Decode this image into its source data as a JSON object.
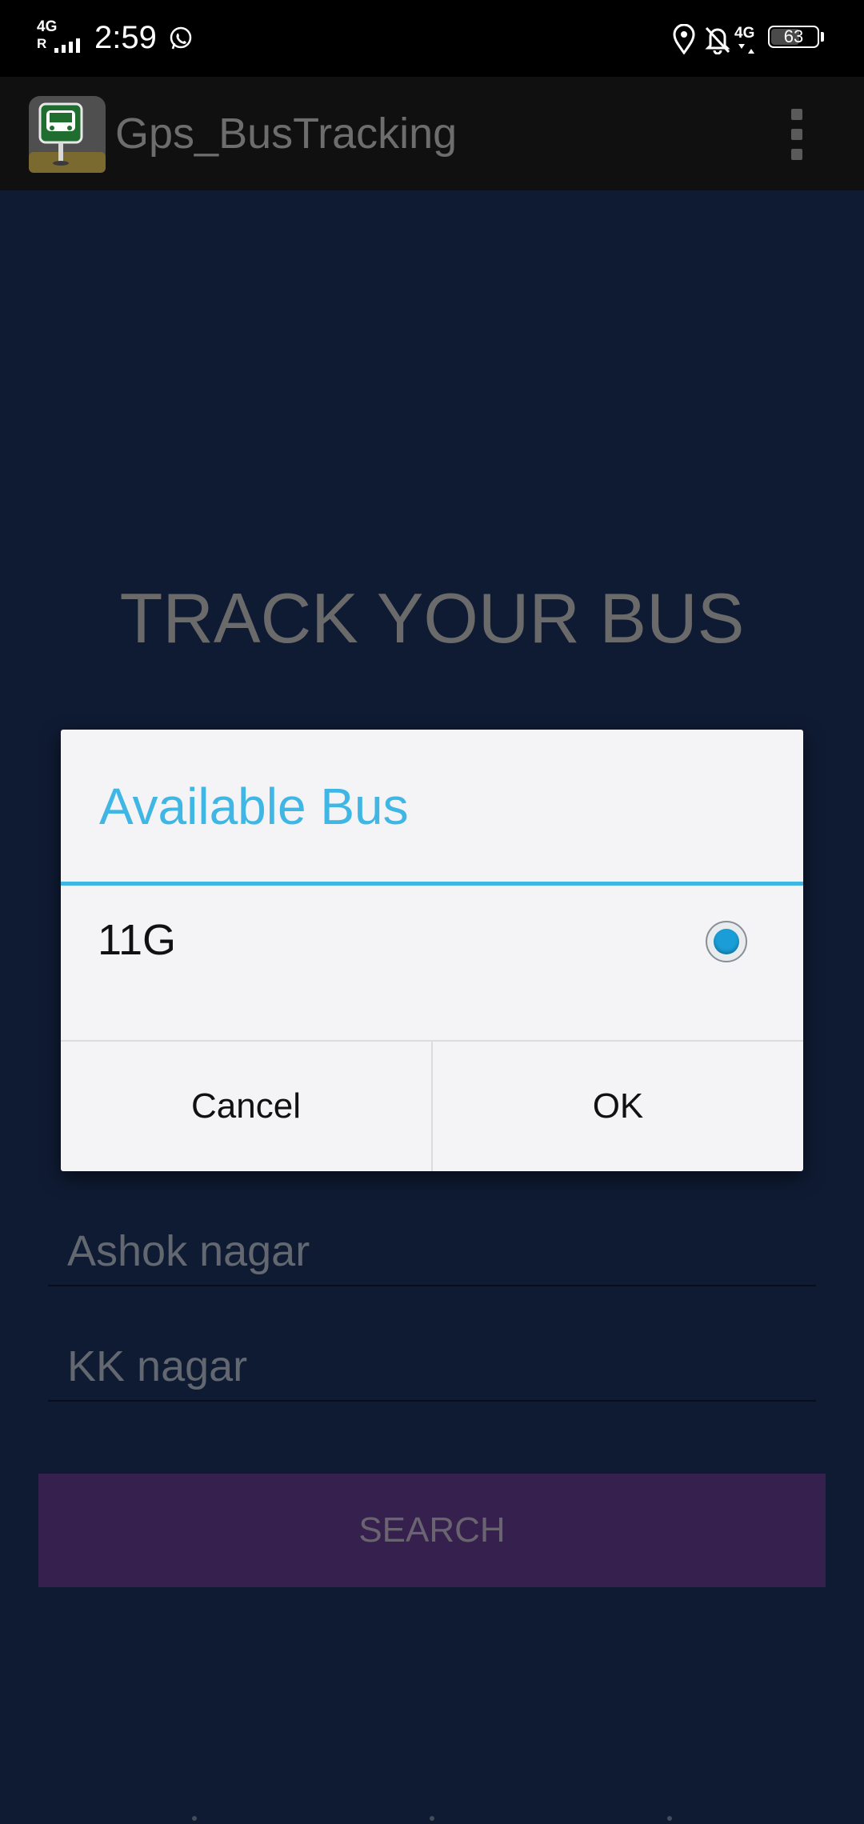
{
  "status_bar": {
    "network_label": "4G",
    "network_sub": "R",
    "time": "2:59",
    "network_type_right": "4G",
    "battery_percent": "63",
    "battery_level": 0.63,
    "icons": [
      "whatsapp-icon",
      "location-icon",
      "bell-off-icon",
      "battery-icon"
    ]
  },
  "app_bar": {
    "title": "Gps_BusTracking",
    "icon": "bus-stop-icon",
    "menu_icon": "overflow-menu-icon"
  },
  "main": {
    "heading": "TRACK YOUR BUS",
    "from_value": "Ashok nagar",
    "to_value": "KK nagar",
    "search_label": "SEARCH"
  },
  "dialog": {
    "title": "Available Bus",
    "options": [
      {
        "label": "11G",
        "selected": true
      }
    ],
    "cancel_label": "Cancel",
    "ok_label": "OK"
  },
  "colors": {
    "accent": "#3fb6e3",
    "background": "#0f1b33",
    "search_button": "#35204e",
    "radio_selected": "#1a9ed8"
  }
}
